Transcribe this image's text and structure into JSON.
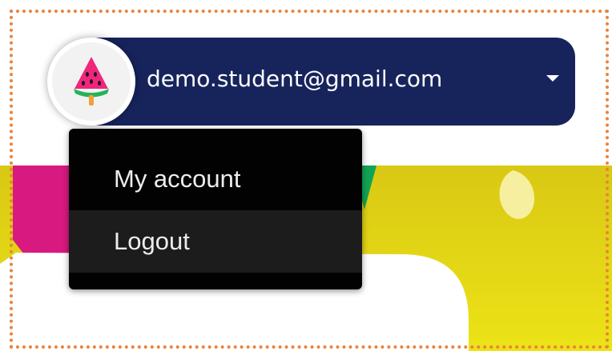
{
  "user": {
    "email": "demo.student@gmail.com",
    "avatar_icon": "watermelon-popsicle-icon",
    "menu_toggle_icon": "caret-down-icon"
  },
  "user_menu": {
    "items": [
      {
        "label": "My account"
      },
      {
        "label": "Logout"
      }
    ]
  },
  "colors": {
    "header_pill": "#17245c",
    "menu_background": "#020202",
    "menu_hover": "#1c1c1c",
    "frame_outline": "#e8843a",
    "banner_yellow": "#e9dd15",
    "banner_pink": "#d8197f",
    "banner_green": "#11a356"
  }
}
